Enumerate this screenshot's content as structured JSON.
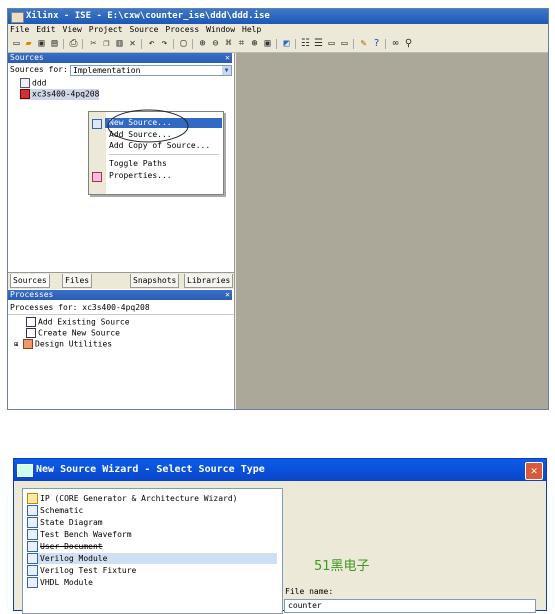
{
  "ise_window": {
    "title": "Xilinx - ISE - E:\\cxw\\counter_ise\\ddd\\ddd.ise",
    "menu": [
      "File",
      "Edit",
      "View",
      "Project",
      "Source",
      "Process",
      "Window",
      "Help"
    ],
    "toolbar_icons": [
      "new-icon",
      "open-icon",
      "save-icon",
      "save-all-icon",
      "print-icon",
      "cut-icon",
      "copy-icon",
      "paste-icon",
      "delete-icon",
      "undo-icon",
      "redo-icon",
      "find-icon",
      "zoom-in-icon",
      "zoom-out-icon",
      "zoom-fit-icon",
      "zoom-area-icon",
      "refresh-icon",
      "run-icon",
      "cascade-icon",
      "tile-horizontal-icon",
      "tile-vertical-icon",
      "window-icon",
      "tools-icon",
      "help-icon",
      "binoculars-icon",
      "search-icon"
    ],
    "sources_panel": {
      "header": "Sources",
      "sources_for_label": "Sources for:",
      "sources_for_value": "Implementation",
      "tree": [
        {
          "label": "ddd",
          "icon": "project-icon"
        },
        {
          "label": "xc3s400-4pq208",
          "icon": "device-icon"
        }
      ],
      "context_menu": [
        {
          "label": "New Source...",
          "selected": true,
          "icon": "new-source-icon"
        },
        {
          "label": "Add Source...",
          "selected": false
        },
        {
          "label": "Add Copy of Source...",
          "selected": false
        },
        {
          "label": "Toggle Paths",
          "selected": false
        },
        {
          "label": "Properties...",
          "selected": false,
          "icon": "properties-icon"
        }
      ],
      "tabs": [
        "Sources",
        "Files",
        "Snapshots",
        "Libraries"
      ]
    },
    "processes_panel": {
      "header": "Processes",
      "processes_for": "Processes for: xc3s400-4pq208",
      "items": [
        "Add Existing Source",
        "Create New Source",
        "Design Utilities"
      ]
    }
  },
  "wizard": {
    "title": "New Source Wizard - Select Source Type",
    "source_types": [
      {
        "label": "IP (CORE Generator & Architecture Wizard)",
        "icon": "ip-core-icon"
      },
      {
        "label": "Schematic",
        "icon": "schematic-icon"
      },
      {
        "label": "State Diagram",
        "icon": "state-diagram-icon"
      },
      {
        "label": "Test Bench Waveform",
        "icon": "waveform-icon"
      },
      {
        "label": "User Document",
        "icon": "document-icon"
      },
      {
        "label": "Verilog Module",
        "icon": "verilog-module-icon"
      },
      {
        "label": "Verilog Test Fixture",
        "icon": "verilog-fixture-icon"
      },
      {
        "label": "VHDL Module",
        "icon": "vhdl-module-icon"
      }
    ],
    "watermark": "51黑电子",
    "file_name_label": "File name:",
    "file_name_value": "counter"
  }
}
